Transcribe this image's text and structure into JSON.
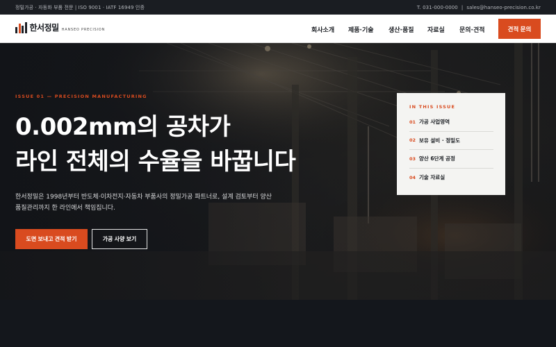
{
  "topbar": {
    "left": "정밀가공 · 자동화 부품 전문 | ISO 9001 · IATF 16949 인증",
    "phone": "T. 031-000-0000",
    "divider": "|",
    "email": "sales@hanseo-precision.co.kr"
  },
  "brand": {
    "name_ko": "한서정밀",
    "name_en": "HANSEO PRECISION",
    "accent_color": "#d94b1f"
  },
  "nav": {
    "items": [
      {
        "label": "회사소개"
      },
      {
        "label": "제품·기술"
      },
      {
        "label": "생산·품질"
      },
      {
        "label": "자료실"
      },
      {
        "label": "문의·견적"
      }
    ],
    "cta_label": "견적 문의"
  },
  "hero": {
    "eyebrow": "ISSUE 01 — PRECISION MANUFACTURING",
    "headline_line1": "0.002mm의 공차가",
    "headline_line2": "라인 전체의 수율을 바꿉니다",
    "description_line1": "한서정밀은 1998년부터 반도체·이차전지·자동차 부품사의 정밀가공 파트너로, 설계 검토부터 양산",
    "description_line2": "품질관리까지 한 라인에서 책임집니다.",
    "primary_button": "도면 보내고 견적 받기",
    "secondary_button": "가공 사양 보기"
  },
  "issue_panel": {
    "title": "IN THIS ISSUE",
    "items": [
      {
        "num": "01",
        "label": "가공 사업영역"
      },
      {
        "num": "02",
        "label": "보유 설비 · 정밀도"
      },
      {
        "num": "03",
        "label": "양산 6단계 공정"
      },
      {
        "num": "04",
        "label": "기술 자료실"
      }
    ]
  }
}
